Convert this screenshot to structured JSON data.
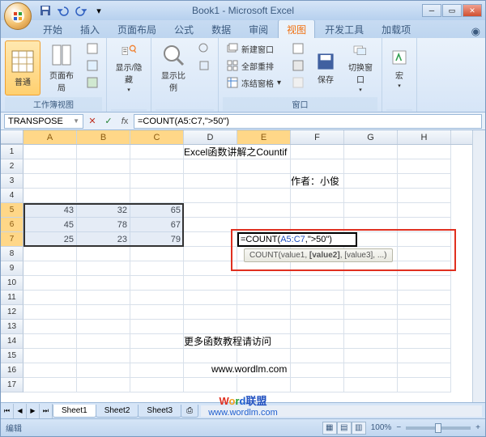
{
  "title": "Book1 - Microsoft Excel",
  "qat": {
    "save": "保存",
    "undo": "撤销",
    "redo": "重做"
  },
  "tabs": [
    "开始",
    "插入",
    "页面布局",
    "公式",
    "数据",
    "审阅",
    "视图",
    "开发工具",
    "加载项"
  ],
  "active_tab": "视图",
  "ribbon": {
    "group1_label": "工作簿视图",
    "normal": "普通",
    "page_layout": "页面布局",
    "group2_label": "",
    "show_hide": "显示/隐藏",
    "zoom_ratio": "显示比例",
    "new_window": "新建窗口",
    "arrange_all": "全部重排",
    "freeze_panes": "冻结窗格",
    "window_label": "窗口",
    "save_workspace": "保存",
    "switch_window": "切换窗口",
    "macros": "宏"
  },
  "formula_bar": {
    "name_box": "TRANSPOSE",
    "formula": "=COUNT(A5:C7,\">50\")"
  },
  "columns": [
    "A",
    "B",
    "C",
    "D",
    "E",
    "F",
    "G",
    "H"
  ],
  "rows_count": 17,
  "cell_text": {
    "title": "Excel函数讲解之Countif",
    "author_label": "作者：小俊",
    "more_text": "更多函数教程请访问",
    "url": "www.wordlm.com",
    "editing_formula": "=COUNT(",
    "editing_ref": "A5:C7",
    "editing_rest": ",\">50\")"
  },
  "tooltip": "COUNT(value1, [value2], [value3], ...)",
  "data_cells": {
    "A5": "43",
    "B5": "32",
    "C5": "65",
    "A6": "45",
    "B6": "78",
    "C6": "67",
    "A7": "25",
    "B7": "23",
    "C7": "79"
  },
  "sheet_tabs": [
    "Sheet1",
    "Sheet2",
    "Sheet3"
  ],
  "status": {
    "mode": "编辑",
    "zoom": "100%"
  },
  "watermark": {
    "brand_cn": "联盟",
    "url": "www.wordlm.com"
  }
}
